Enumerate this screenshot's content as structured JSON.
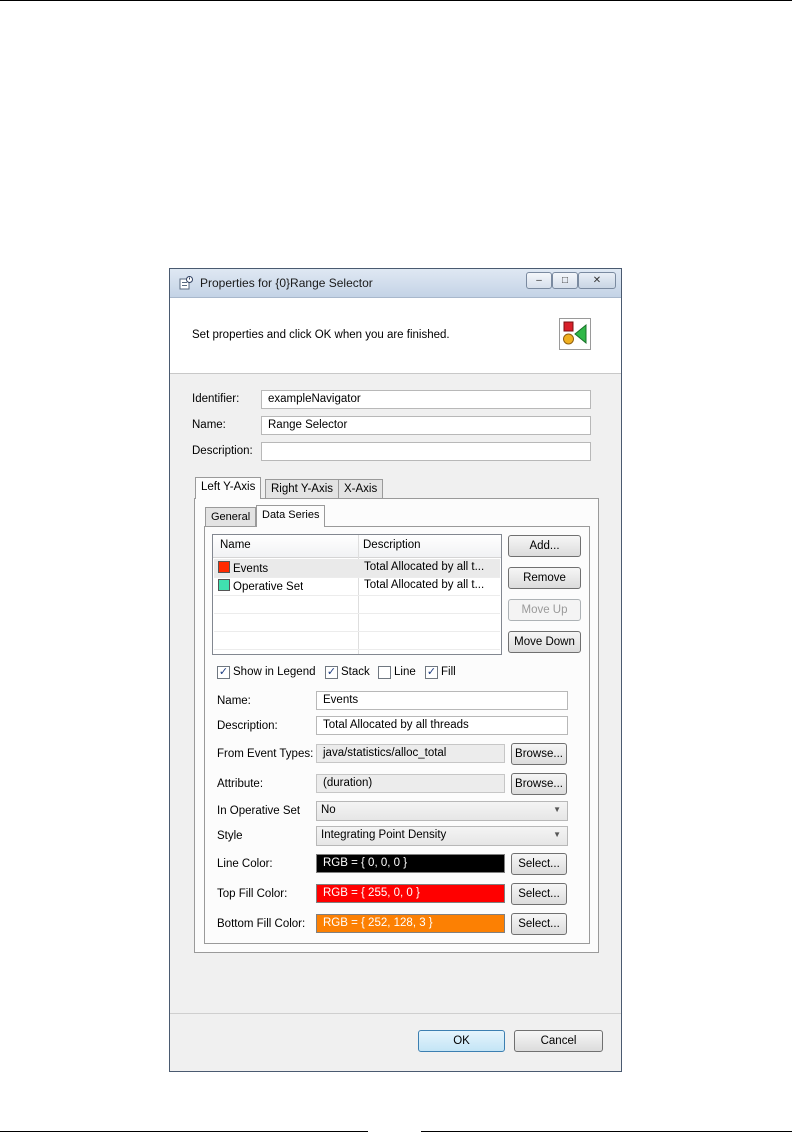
{
  "window": {
    "title": "Properties for {0}Range Selector",
    "header_text": "Set properties and click OK when you are finished.",
    "controls": {
      "minimize": "–",
      "maximize": "□",
      "close": "✕"
    }
  },
  "form": {
    "identifier_label": "Identifier:",
    "identifier_value": "exampleNavigator",
    "name_label": "Name:",
    "name_value": "Range Selector",
    "description_label": "Description:",
    "description_value": ""
  },
  "tabs": [
    "Left Y-Axis",
    "Right Y-Axis",
    "X-Axis"
  ],
  "subtabs": [
    "General",
    "Data Series"
  ],
  "series_table": {
    "columns": [
      "Name",
      "Description"
    ],
    "rows": [
      {
        "name": "Events",
        "description": "Total Allocated by all t...",
        "color": "#ff2a00"
      },
      {
        "name": "Operative Set",
        "description": "Total Allocated by all t...",
        "color": "#40e0b0"
      }
    ]
  },
  "series_buttons": {
    "add": "Add...",
    "remove": "Remove",
    "move_up": "Move Up",
    "move_down": "Move Down"
  },
  "options": {
    "show_in_legend": {
      "label": "Show in Legend",
      "checked": true
    },
    "stack": {
      "label": "Stack",
      "checked": true
    },
    "line": {
      "label": "Line",
      "checked": false
    },
    "fill": {
      "label": "Fill",
      "checked": true
    }
  },
  "series_detail": {
    "name_label": "Name:",
    "name_value": "Events",
    "description_label": "Description:",
    "description_value": "Total Allocated by all threads",
    "event_types_label": "From Event Types:",
    "event_types_value": "java/statistics/alloc_total",
    "attribute_label": "Attribute:",
    "attribute_value": "(duration)",
    "operative_label": "In Operative Set",
    "operative_value": "No",
    "style_label": "Style",
    "style_value": "Integrating Point Density",
    "line_color_label": "Line Color:",
    "line_color_value": "RGB = { 0, 0, 0 }",
    "line_color": "#000000",
    "top_fill_label": "Top Fill Color:",
    "top_fill_value": "RGB = { 255, 0, 0 }",
    "top_fill_color": "#ff0000",
    "bottom_fill_label": "Bottom Fill Color:",
    "bottom_fill_value": "RGB = { 252, 128, 3 }",
    "bottom_fill_color": "#fc8003",
    "browse_label": "Browse...",
    "select_label": "Select..."
  },
  "footer": {
    "ok": "OK",
    "cancel": "Cancel"
  }
}
